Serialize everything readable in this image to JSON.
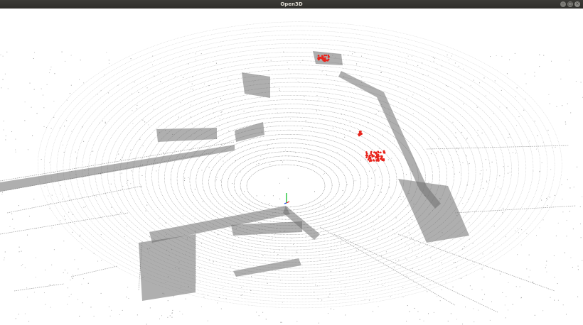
{
  "window": {
    "title": "Open3D",
    "controls": {
      "minimize_icon": "–",
      "maximize_icon": "□",
      "close_icon": "×"
    }
  },
  "scene": {
    "background_color": "#ffffff",
    "point_color": "#6e6e6e",
    "highlight_color": "#e8241c",
    "axis_colors": {
      "x": "#e8241c",
      "y": "#21c43a",
      "z": "#1e50e8"
    }
  }
}
